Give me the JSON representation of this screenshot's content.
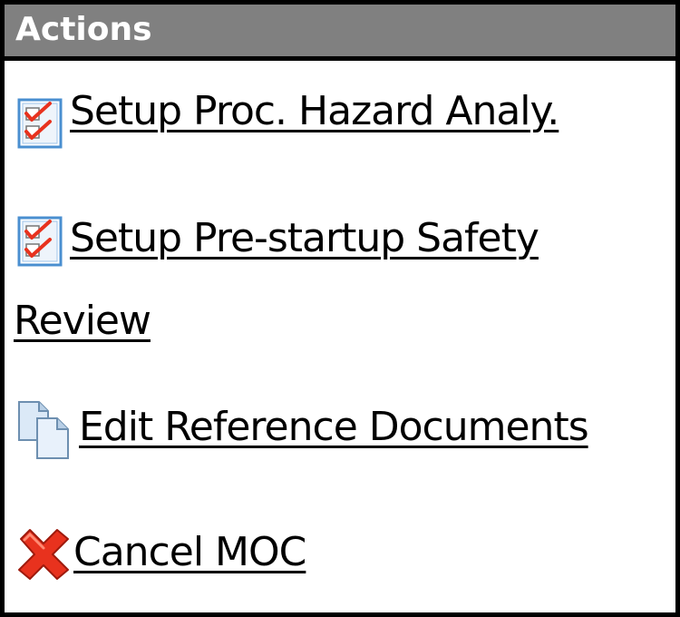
{
  "panel": {
    "title": "Actions"
  },
  "actions": [
    {
      "label": "Setup Proc. Hazard Analy.",
      "icon": "checklist-icon"
    },
    {
      "label": "Setup Pre-startup Safety Review",
      "icon": "checklist-icon"
    },
    {
      "label": "Edit Reference Documents",
      "icon": "documents-icon"
    },
    {
      "label": "Cancel MOC",
      "icon": "red-x-icon"
    }
  ],
  "colors": {
    "header_bg": "#808080",
    "header_text": "#ffffff",
    "border": "#000000",
    "link_text": "#000000",
    "check_red": "#e8321e",
    "icon_blue": "#5b9bd5"
  }
}
